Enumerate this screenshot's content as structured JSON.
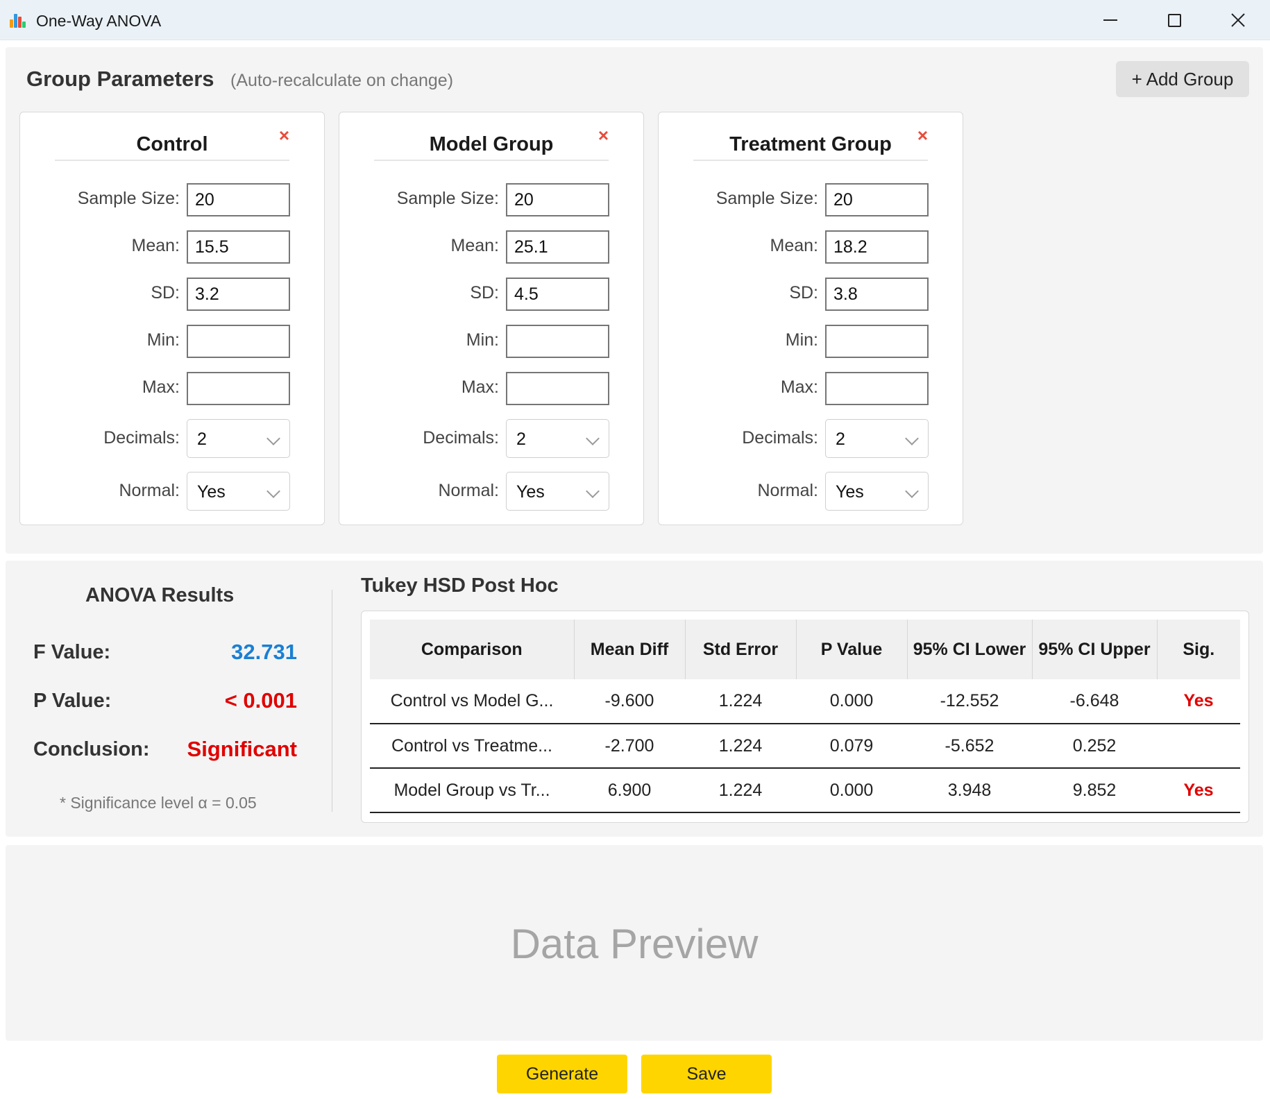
{
  "window": {
    "title": "One-Way ANOVA",
    "minimize_icon": "minimize-icon",
    "maximize_icon": "maximize-icon",
    "close_icon": "close-icon",
    "app_icon_colors": [
      "#f39c12",
      "#3498db",
      "#e74c3c",
      "#2ecc71"
    ]
  },
  "params": {
    "title": "Group Parameters",
    "subtitle": "(Auto-recalculate on change)",
    "add_button": "+ Add Group",
    "labels": {
      "sample_size": "Sample Size:",
      "mean": "Mean:",
      "sd": "SD:",
      "min": "Min:",
      "max": "Max:",
      "decimals": "Decimals:",
      "normal": "Normal:"
    },
    "remove_glyph": "×",
    "groups": [
      {
        "name": "Control",
        "sample_size": "20",
        "mean": "15.5",
        "sd": "3.2",
        "min": "",
        "max": "",
        "decimals": "2",
        "normal": "Yes"
      },
      {
        "name": "Model Group",
        "sample_size": "20",
        "mean": "25.1",
        "sd": "4.5",
        "min": "",
        "max": "",
        "decimals": "2",
        "normal": "Yes"
      },
      {
        "name": "Treatment Group",
        "sample_size": "20",
        "mean": "18.2",
        "sd": "3.8",
        "min": "",
        "max": "",
        "decimals": "2",
        "normal": "Yes"
      }
    ]
  },
  "anova": {
    "title": "ANOVA Results",
    "f_label": "F Value:",
    "f_value": "32.731",
    "p_label": "P Value:",
    "p_value": "< 0.001",
    "conclusion_label": "Conclusion:",
    "conclusion": "Significant",
    "note": "* Significance level α = 0.05",
    "colors": {
      "f_value": "#1a7fd4",
      "p_value": "#e00000",
      "conclusion": "#e00000"
    }
  },
  "tukey": {
    "title": "Tukey HSD Post Hoc",
    "headers": [
      "Comparison",
      "Mean Diff",
      "Std Error",
      "P Value",
      "95% CI Lower",
      "95% CI Upper",
      "Sig."
    ],
    "rows": [
      [
        "Control vs Model G...",
        "-9.600",
        "1.224",
        "0.000",
        "-12.552",
        "-6.648",
        "Yes"
      ],
      [
        "Control vs Treatme...",
        "-2.700",
        "1.224",
        "0.079",
        "-5.652",
        "0.252",
        ""
      ],
      [
        "Model Group vs Tr...",
        "6.900",
        "1.224",
        "0.000",
        "3.948",
        "9.852",
        "Yes"
      ]
    ]
  },
  "preview": {
    "label": "Data Preview"
  },
  "actions": {
    "generate": "Generate",
    "save": "Save",
    "color": "#ffd500"
  }
}
